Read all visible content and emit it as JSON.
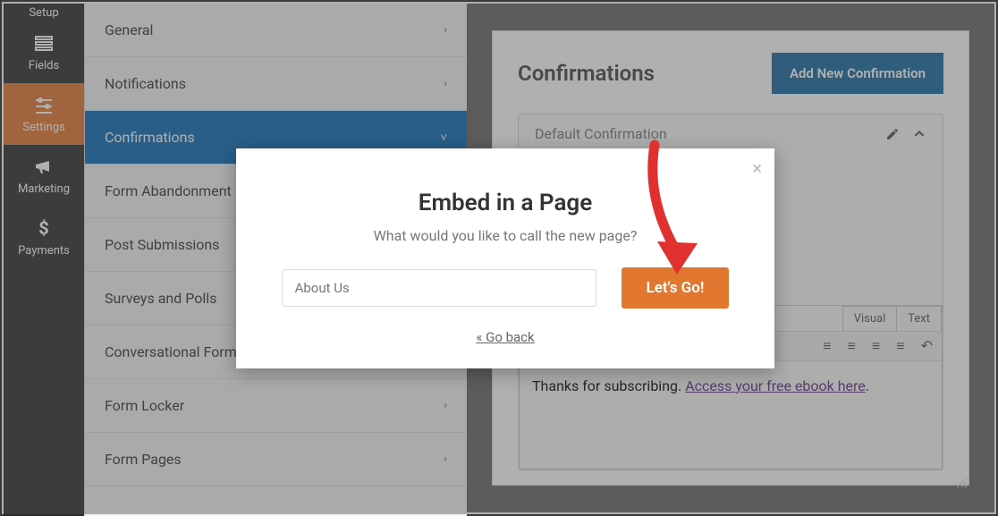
{
  "sidebar": {
    "items": [
      {
        "label": "Setup",
        "icon": "setup"
      },
      {
        "label": "Fields",
        "icon": "list"
      },
      {
        "label": "Settings",
        "icon": "sliders",
        "active": true
      },
      {
        "label": "Marketing",
        "icon": "bullhorn"
      },
      {
        "label": "Payments",
        "icon": "dollar"
      }
    ]
  },
  "settings_panel": {
    "items": [
      {
        "label": "General",
        "chev": "›"
      },
      {
        "label": "Notifications",
        "chev": "›"
      },
      {
        "label": "Confirmations",
        "chev": "˅",
        "active": true
      },
      {
        "label": "Form Abandonment",
        "chev": ""
      },
      {
        "label": "Post Submissions",
        "chev": "›"
      },
      {
        "label": "Surveys and Polls",
        "chev": "›"
      },
      {
        "label": "Conversational Forms",
        "chev": ""
      },
      {
        "label": "Form Locker",
        "chev": "›"
      },
      {
        "label": "Form Pages",
        "chev": "›"
      }
    ]
  },
  "main": {
    "title": "Confirmations",
    "add_button": "Add New Confirmation",
    "conf_name": "Default Confirmation",
    "editor_tabs": {
      "visual": "Visual",
      "text": "Text"
    },
    "editor_body_prefix": "Thanks for subscribing. ",
    "editor_body_link": "Access your free ebook here",
    "editor_body_suffix": "."
  },
  "modal": {
    "title": "Embed in a Page",
    "subtitle": "What would you like to call the new page?",
    "input_value": "About Us",
    "go": "Let's Go!",
    "back": "« Go back"
  }
}
